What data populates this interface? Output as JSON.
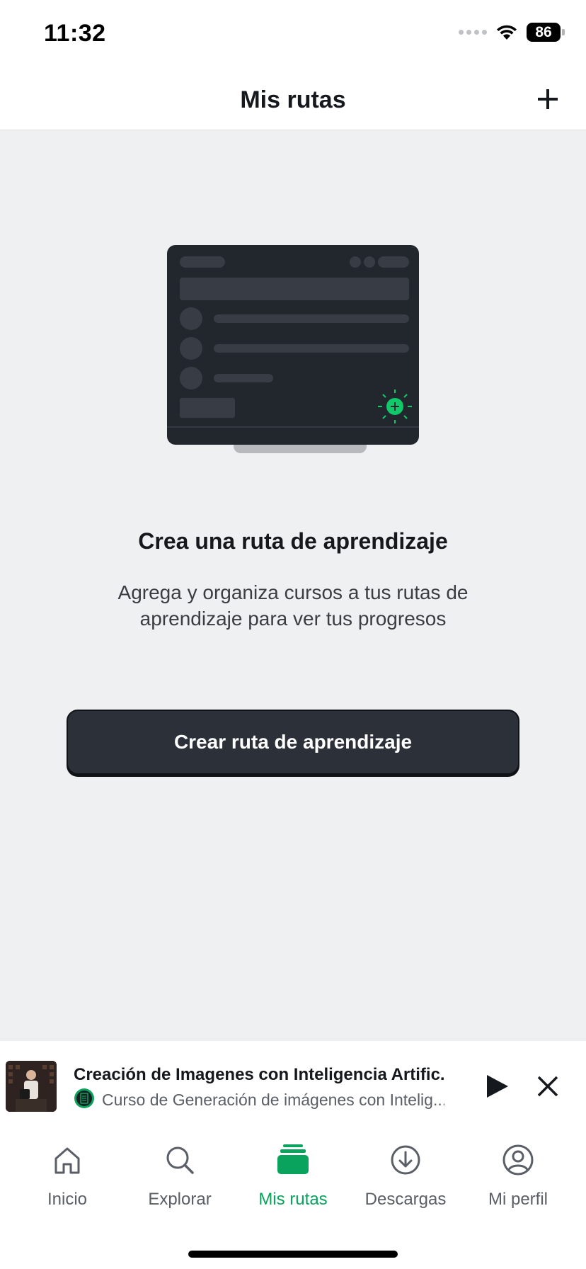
{
  "status_bar": {
    "time": "11:32",
    "battery": "86"
  },
  "header": {
    "title": "Mis rutas",
    "add_icon": "plus-icon"
  },
  "empty_state": {
    "title": "Crea una ruta de aprendizaje",
    "description": "Agrega y organiza cursos a tus rutas de aprendizaje para ver tus progresos",
    "button_label": "Crear ruta de aprendizaje"
  },
  "mini_player": {
    "title": "Creación de Imagenes con Inteligencia Artific...",
    "subtitle": "Curso de Generación de imágenes con Intelig...",
    "play_icon": "play-icon",
    "close_icon": "close-icon"
  },
  "tabs": [
    {
      "label": "Inicio",
      "icon": "home-icon"
    },
    {
      "label": "Explorar",
      "icon": "search-icon"
    },
    {
      "label": "Mis rutas",
      "icon": "stack-icon",
      "active": true
    },
    {
      "label": "Descargas",
      "icon": "download-icon"
    },
    {
      "label": "Mi perfil",
      "icon": "profile-icon"
    }
  ],
  "colors": {
    "accent": "#0aa35d",
    "button": "#2b3039",
    "background": "#eff0f2"
  }
}
